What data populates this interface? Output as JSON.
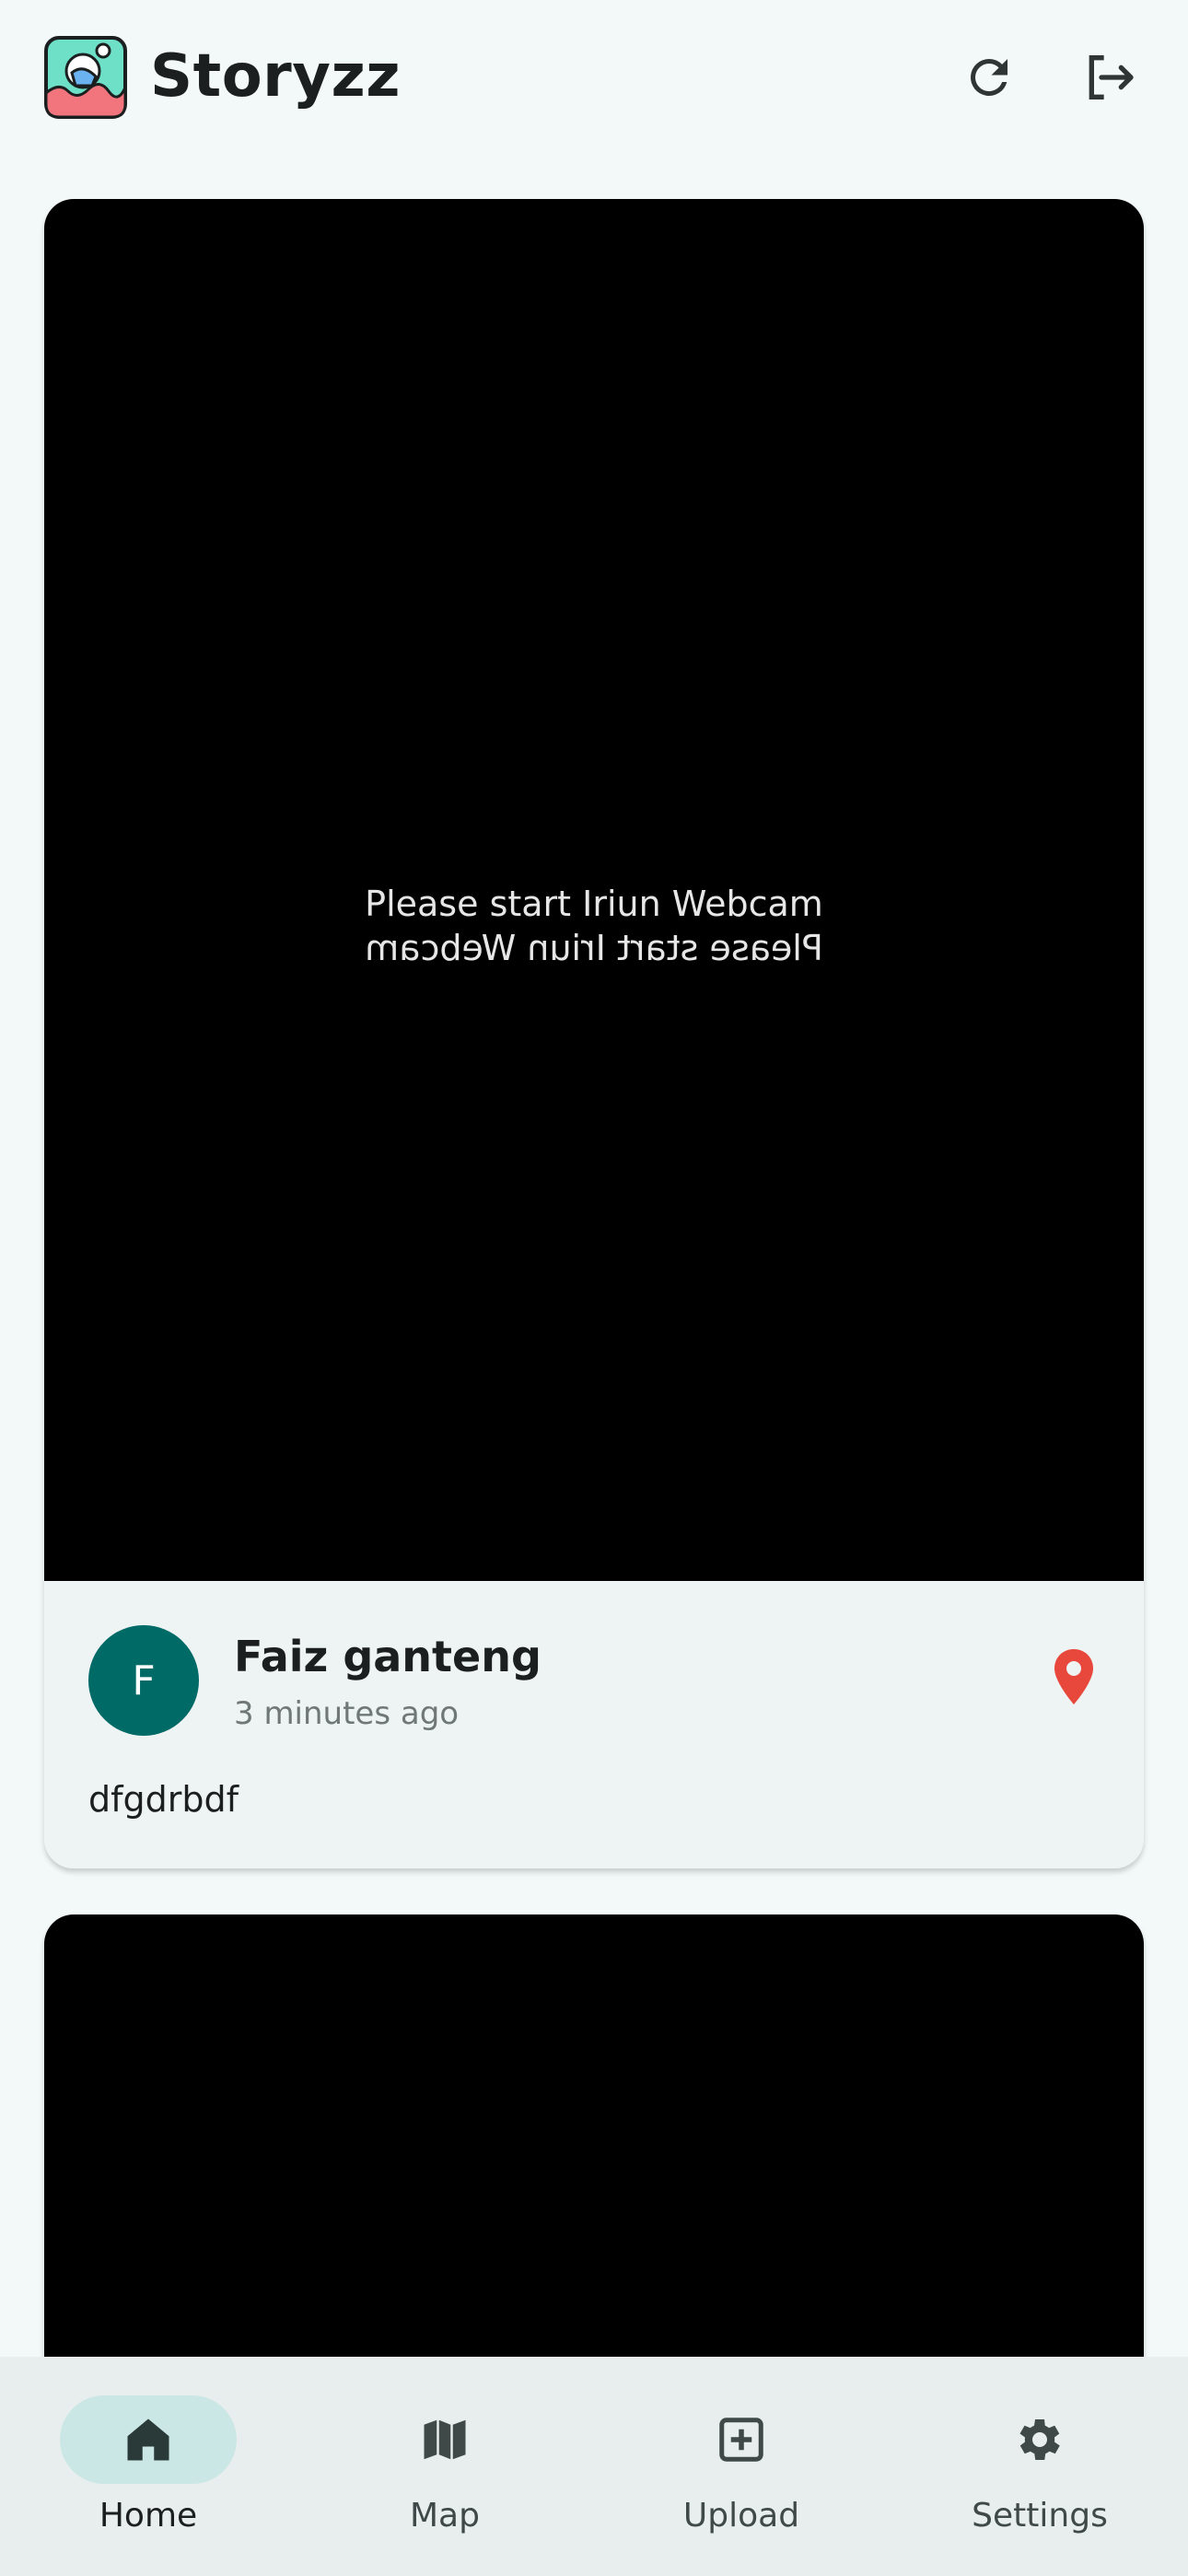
{
  "app": {
    "title": "Storyzz"
  },
  "header": {
    "actions": [
      {
        "name": "refresh",
        "icon": "refresh-icon"
      },
      {
        "name": "logout",
        "icon": "logout-icon"
      }
    ]
  },
  "stories": [
    {
      "image_text_line": "Please start Iriun Webcam",
      "avatar_initial": "F",
      "author": "Faiz ganteng",
      "time": "3 minutes ago",
      "description": "dfgdrbdf",
      "has_location": true
    },
    {
      "image_text_line": "",
      "avatar_initial": "",
      "author": "",
      "time": "",
      "description": ""
    }
  ],
  "nav": {
    "items": [
      {
        "label": "Home",
        "icon": "home-icon",
        "selected": true
      },
      {
        "label": "Map",
        "icon": "map-icon",
        "selected": false
      },
      {
        "label": "Upload",
        "icon": "add-box-icon",
        "selected": false
      },
      {
        "label": "Settings",
        "icon": "gear-icon",
        "selected": false
      }
    ]
  },
  "colors": {
    "background": "#f3f9f8",
    "primary": "#006a67",
    "nav_indicator": "#cbe7e5",
    "location_pin": "#e8473b",
    "card": "#eef3f3"
  }
}
